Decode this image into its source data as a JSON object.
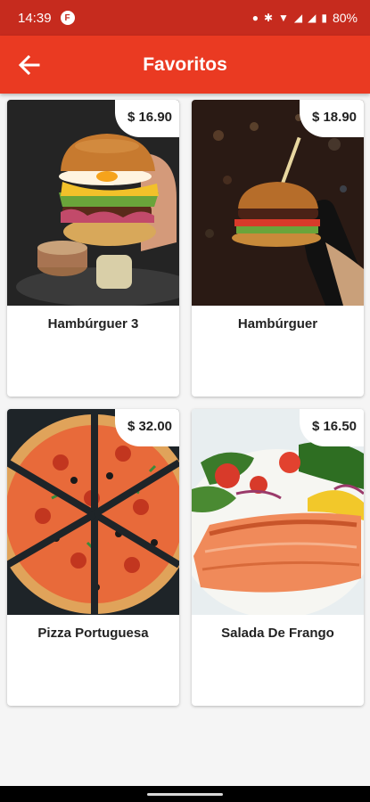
{
  "status_bar": {
    "time": "14:39",
    "app_icon": "F",
    "battery": "80%"
  },
  "app_bar": {
    "title": "Favoritos"
  },
  "favorites": [
    {
      "name": "Hambúrguer 3",
      "price": "$ 16.90",
      "image": "burger-egg-photo"
    },
    {
      "name": "Hambúrguer",
      "price": "$ 18.90",
      "image": "burger-gloved-hand-photo"
    },
    {
      "name": "Pizza Portuguesa",
      "price": "$ 32.00",
      "image": "pizza-photo"
    },
    {
      "name": "Salada De Frango",
      "price": "$ 16.50",
      "image": "salmon-salad-photo"
    }
  ],
  "colors": {
    "status_bar": "#c62b1e",
    "app_bar": "#ea3a22",
    "background": "#f5f5f5"
  }
}
